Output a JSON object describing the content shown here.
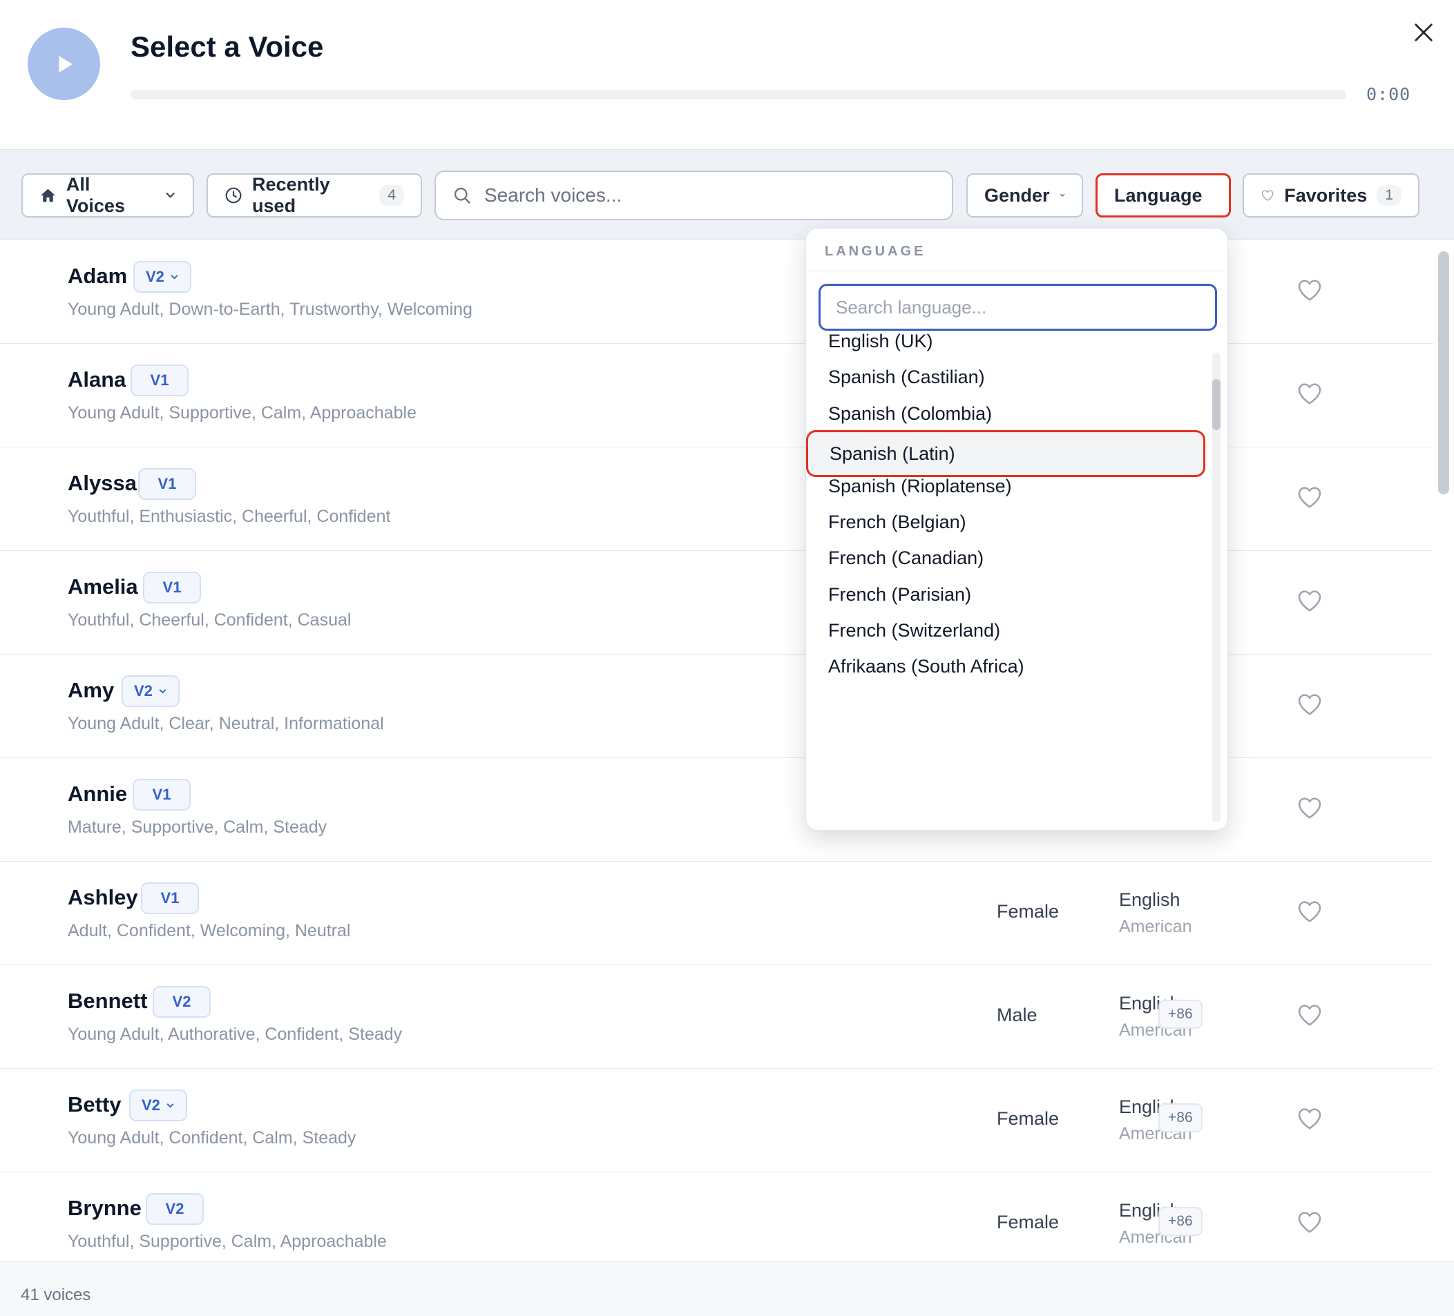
{
  "header": {
    "title": "Select a Voice",
    "time": "0:00"
  },
  "toolbar": {
    "all_voices": "All Voices",
    "recently_used": "Recently used",
    "recently_used_count": "4",
    "search_placeholder": "Search voices...",
    "gender": "Gender",
    "language": "Language",
    "favorites": "Favorites",
    "favorites_count": "1"
  },
  "voices": [
    {
      "name": "Adam",
      "version": "V2",
      "has_menu": true,
      "description": "Young Adult, Down-to-Earth, Trustworthy, Welcoming"
    },
    {
      "name": "Alana",
      "version": "V1",
      "has_menu": false,
      "description": "Young Adult, Supportive, Calm, Approachable"
    },
    {
      "name": "Alyssa",
      "version": "V1",
      "has_menu": false,
      "description": "Youthful, Enthusiastic, Cheerful, Confident"
    },
    {
      "name": "Amelia",
      "version": "V1",
      "has_menu": false,
      "description": "Youthful, Cheerful, Confident, Casual"
    },
    {
      "name": "Amy",
      "version": "V2",
      "has_menu": true,
      "description": "Young Adult, Clear, Neutral, Informational"
    },
    {
      "name": "Annie",
      "version": "V1",
      "has_menu": false,
      "description": "Mature, Supportive, Calm, Steady"
    },
    {
      "name": "Ashley",
      "version": "V1",
      "has_menu": false,
      "description": "Adult, Confident, Welcoming, Neutral",
      "gender": "Female",
      "language": "English",
      "accent": "American"
    },
    {
      "name": "Bennett",
      "version": "V2",
      "has_menu": false,
      "description": "Young Adult, Authorative, Confident, Steady",
      "gender": "Male",
      "language": "English",
      "accent": "American",
      "more": "+86"
    },
    {
      "name": "Betty",
      "version": "V2",
      "has_menu": true,
      "description": "Young Adult, Confident, Calm, Steady",
      "gender": "Female",
      "language": "English",
      "accent": "American",
      "more": "+86"
    },
    {
      "name": "Brynne",
      "version": "V2",
      "has_menu": false,
      "description": "Youthful, Supportive, Calm, Approachable",
      "gender": "Female",
      "language": "English",
      "accent": "American",
      "more": "+86"
    }
  ],
  "footer": {
    "count": "41 voices"
  },
  "language_dropdown": {
    "heading": "LANGUAGE",
    "search_placeholder": "Search language...",
    "options": [
      "English (UK)",
      "Spanish (Castilian)",
      "Spanish (Colombia)",
      "Spanish (Latin)",
      "Spanish (Rioplatense)",
      "French (Belgian)",
      "French (Canadian)",
      "French (Parisian)",
      "French (Switzerland)",
      "Afrikaans (South Africa)"
    ],
    "selected": "Spanish (Latin)"
  },
  "colors": {
    "accent_blue": "#3261c9",
    "highlight_red": "#e0321e",
    "play_button": "#a9bfec"
  },
  "icons": [
    "play-icon",
    "close-icon",
    "home-icon",
    "chevron-down-icon",
    "clock-icon",
    "search-icon",
    "chevron-up-icon",
    "heart-icon"
  ]
}
